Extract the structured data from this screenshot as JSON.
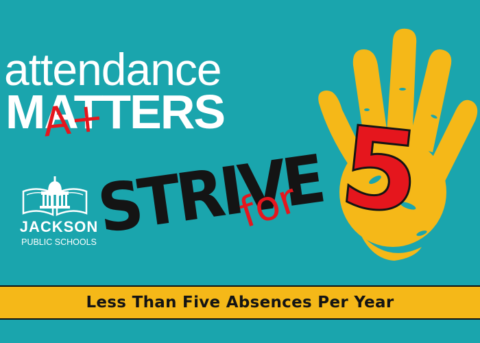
{
  "headline": {
    "line1": "attendance",
    "line2": "MATTERS",
    "grade_mark": "A+"
  },
  "logo": {
    "name": "JACKSON",
    "subtitle": "PUBLIC SCHOOLS"
  },
  "slogan": {
    "word1": "STRIVE",
    "word2": "for",
    "number": "5"
  },
  "banner": {
    "text": "Less Than Five Absences Per Year"
  },
  "colors": {
    "background": "#1aa5ad",
    "banner": "#f5b818",
    "handprint": "#f5b818",
    "accent_red": "#e5161d",
    "text_black": "#141414",
    "text_white": "#ffffff"
  },
  "icons": [
    "handprint-icon",
    "jps-building-book-icon"
  ]
}
